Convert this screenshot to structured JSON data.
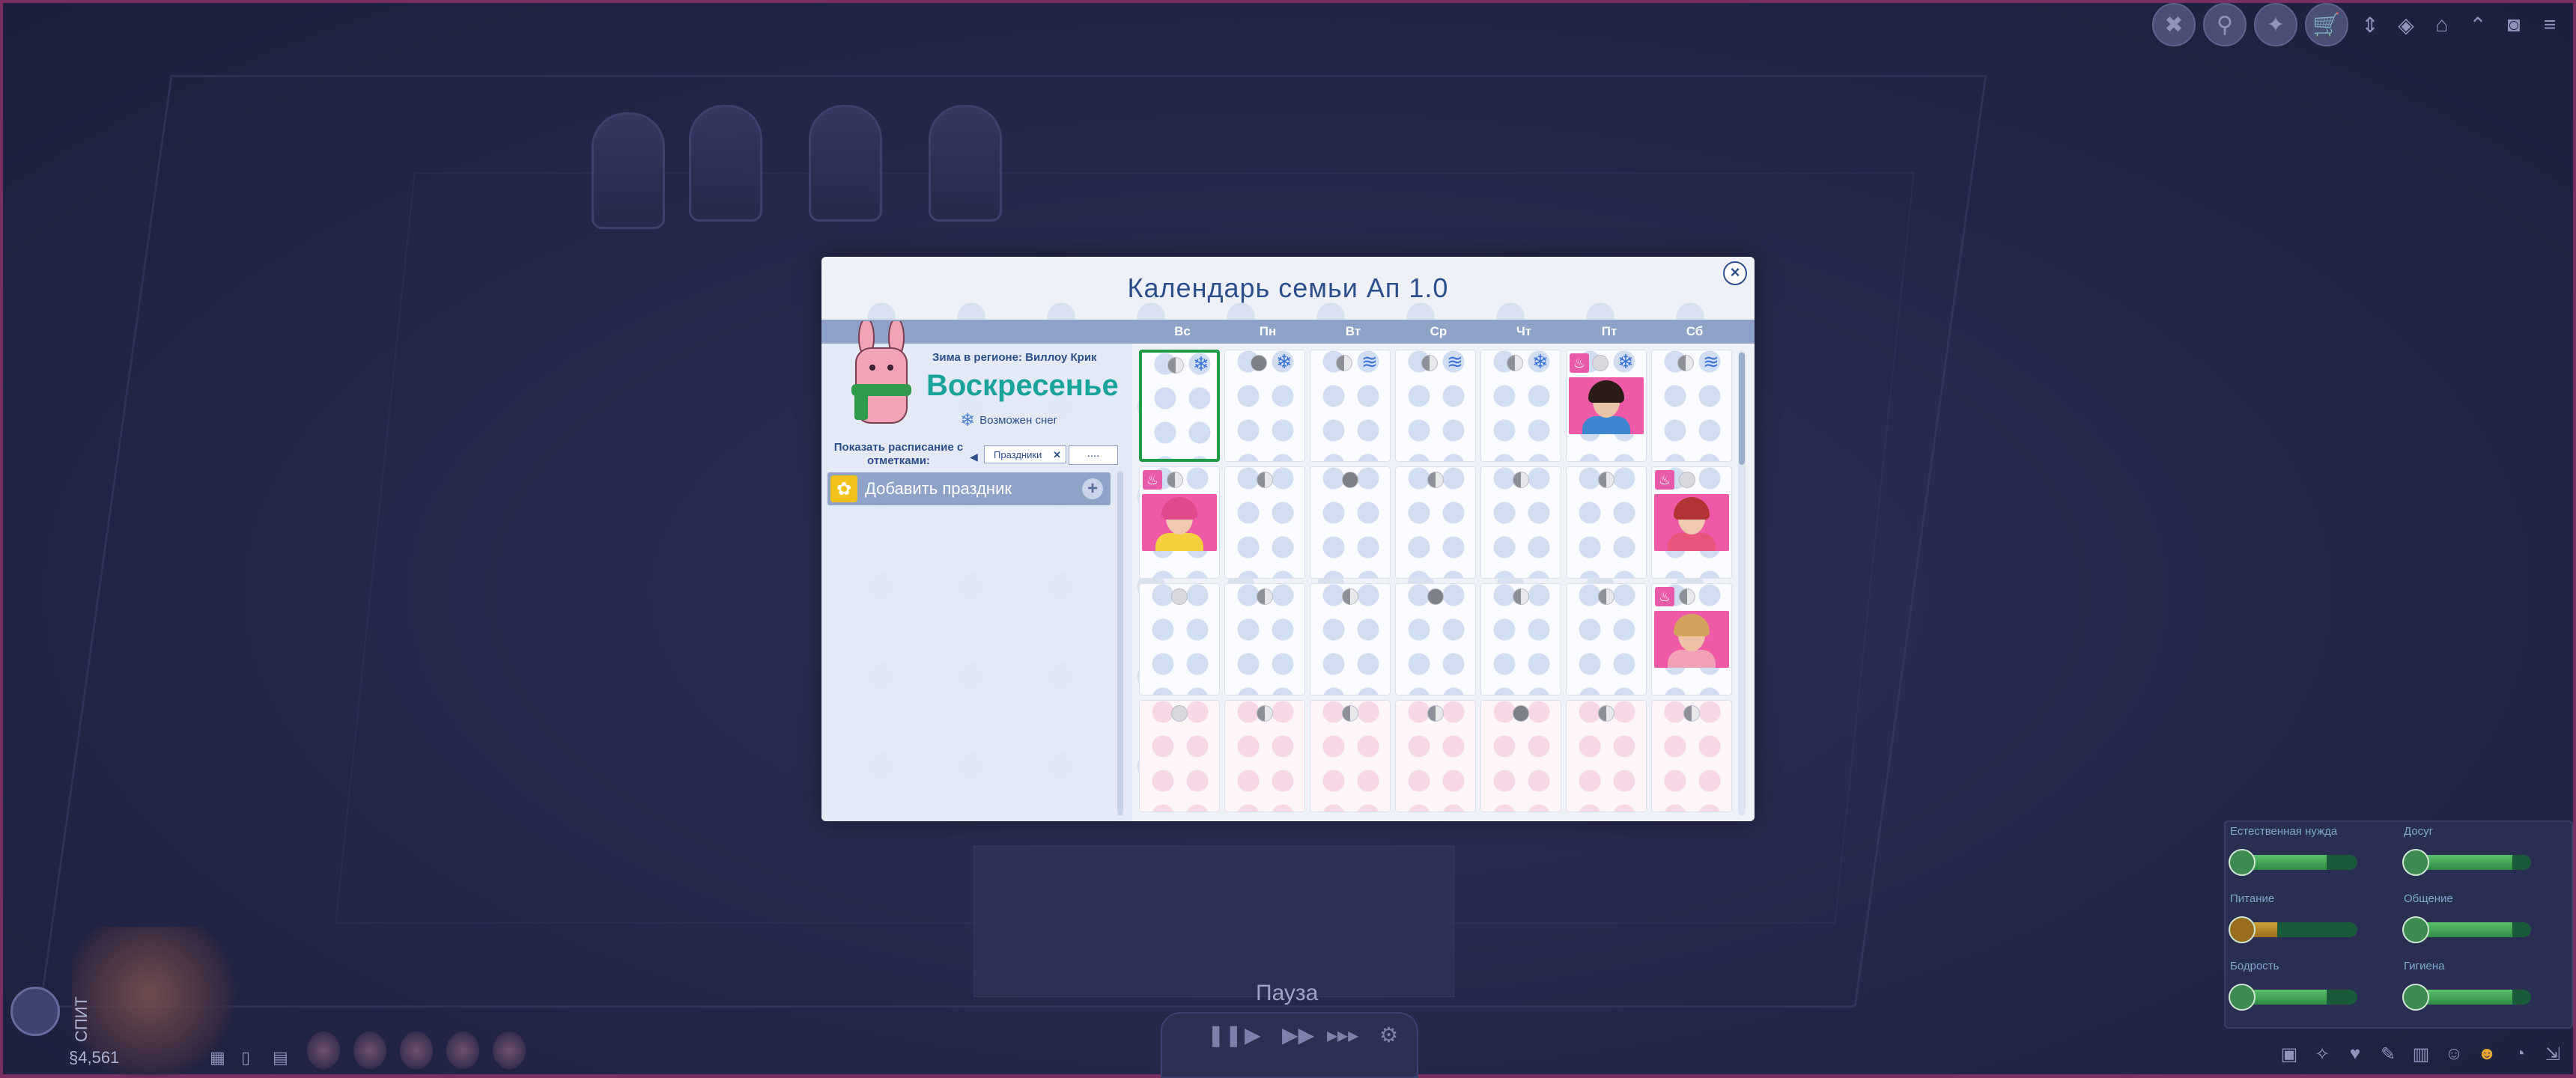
{
  "dialog": {
    "title": "Календарь семьи Ап 1.0",
    "close_icon": "close-icon",
    "days": [
      "Вс",
      "Пн",
      "Вт",
      "Ср",
      "Чт",
      "Пт",
      "Сб"
    ],
    "region": "Зима в регионе: Виллоу Крик",
    "day_name": "Воскресенье",
    "weather_text": "Возможен снег",
    "schedule_label": "Показать расписание с отметками:",
    "filter_chip": "Праздники",
    "filter_more": "....",
    "add_holiday": "Добавить праздник"
  },
  "calendar": {
    "today_index": 0,
    "weeks": [
      [
        {
          "moon": "half",
          "weather": "snow",
          "pink": false
        },
        {
          "moon": "new",
          "weather": "snow",
          "pink": false
        },
        {
          "moon": "half",
          "weather": "wind",
          "pink": false
        },
        {
          "moon": "half",
          "weather": "wind",
          "pink": false
        },
        {
          "moon": "half",
          "weather": "snow",
          "pink": false
        },
        {
          "moon": "full",
          "weather": "snow",
          "pink": false,
          "birthday": "boy"
        },
        {
          "moon": "half",
          "weather": "wind",
          "pink": false
        }
      ],
      [
        {
          "moon": "half",
          "weather": "",
          "pink": false,
          "birthday": "girl-pink"
        },
        {
          "moon": "half",
          "weather": "",
          "pink": false
        },
        {
          "moon": "new",
          "weather": "",
          "pink": false
        },
        {
          "moon": "half",
          "weather": "",
          "pink": false
        },
        {
          "moon": "half",
          "weather": "",
          "pink": false
        },
        {
          "moon": "half",
          "weather": "",
          "pink": false
        },
        {
          "moon": "full",
          "weather": "",
          "pink": false,
          "birthday": "girl-red"
        }
      ],
      [
        {
          "moon": "full",
          "weather": "",
          "pink": false
        },
        {
          "moon": "half",
          "weather": "",
          "pink": false
        },
        {
          "moon": "half",
          "weather": "",
          "pink": false
        },
        {
          "moon": "new",
          "weather": "",
          "pink": false
        },
        {
          "moon": "half",
          "weather": "",
          "pink": false
        },
        {
          "moon": "half",
          "weather": "",
          "pink": false
        },
        {
          "moon": "half",
          "weather": "",
          "pink": false,
          "birthday": "woman-blonde"
        }
      ],
      [
        {
          "moon": "full",
          "weather": "",
          "pink": true
        },
        {
          "moon": "half",
          "weather": "",
          "pink": true
        },
        {
          "moon": "half",
          "weather": "",
          "pink": true
        },
        {
          "moon": "half",
          "weather": "",
          "pink": true
        },
        {
          "moon": "new",
          "weather": "",
          "pink": true
        },
        {
          "moon": "half",
          "weather": "",
          "pink": true
        },
        {
          "moon": "half",
          "weather": "",
          "pink": true
        }
      ]
    ]
  },
  "needs": {
    "items": [
      {
        "label": "Естественная нужда",
        "level": 0.75
      },
      {
        "label": "Досуг",
        "level": 0.85
      },
      {
        "label": "Питание",
        "level": 0.35,
        "low": true
      },
      {
        "label": "Общение",
        "level": 0.85
      },
      {
        "label": "Бодрость",
        "level": 0.75
      },
      {
        "label": "Гигиена",
        "level": 0.85
      }
    ]
  },
  "hud": {
    "pause_label": "Пауза",
    "sleep_label": "СПИТ",
    "money": "§4,561"
  }
}
